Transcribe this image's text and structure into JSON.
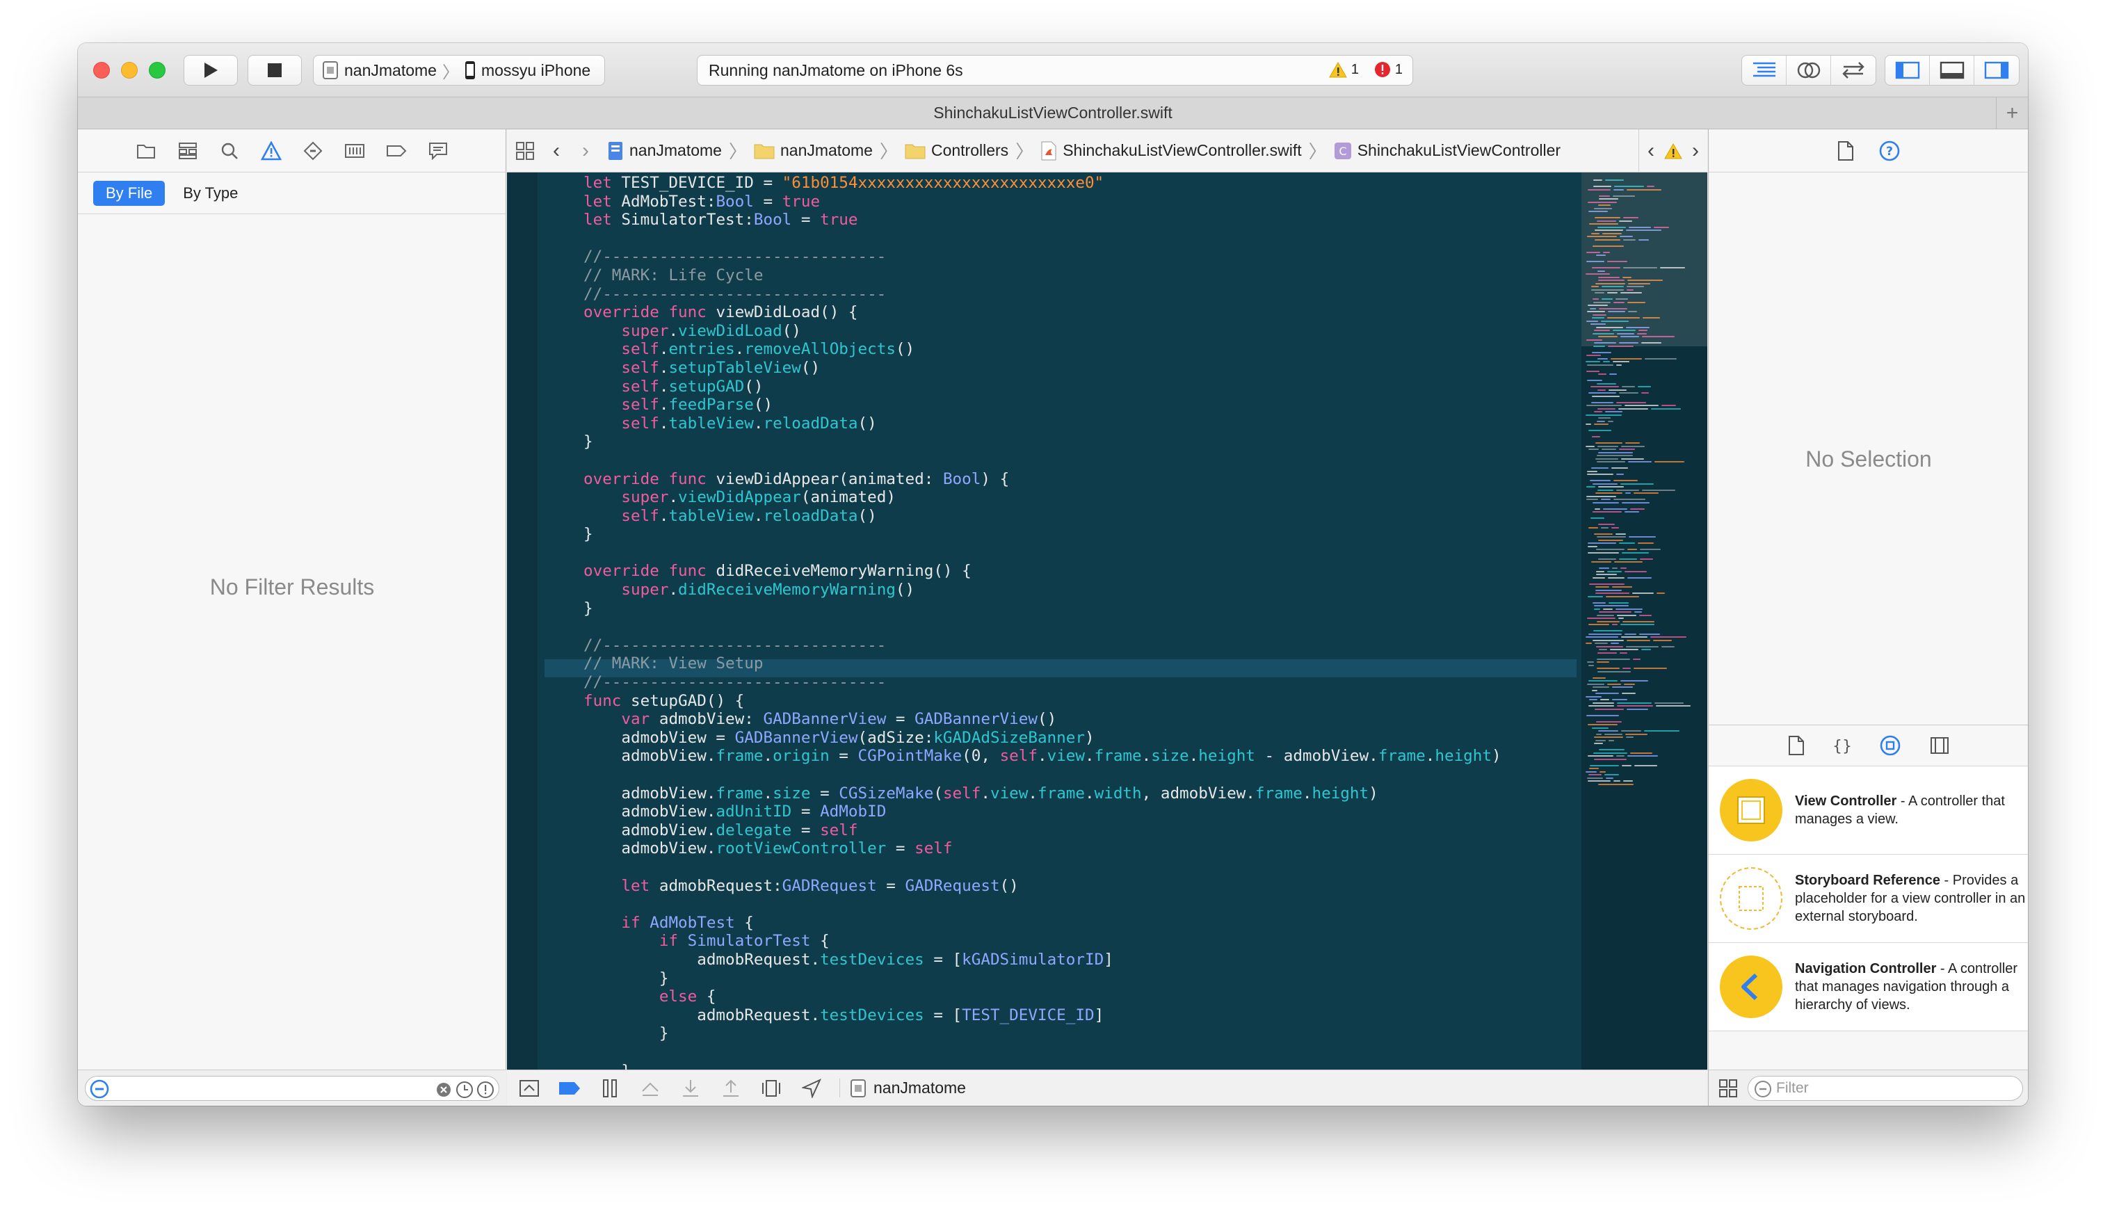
{
  "toolbar": {
    "scheme": "nanJmatome",
    "device": "mossyu  iPhone",
    "status": "Running nanJmatome on iPhone 6s",
    "warning_count": "1",
    "error_count": "1"
  },
  "tab": {
    "title": "ShinchakuListViewController.swift"
  },
  "navigator": {
    "scope_by_file": "By File",
    "scope_by_type": "By Type",
    "empty": "No Filter Results"
  },
  "jumpbar": {
    "project": "nanJmatome",
    "group": "nanJmatome",
    "folder": "Controllers",
    "file": "ShinchakuListViewController.swift",
    "symbol": "ShinchakuListViewController"
  },
  "debugbar": {
    "target": "nanJmatome"
  },
  "inspector": {
    "empty": "No Selection",
    "filter_placeholder": "Filter",
    "library": [
      {
        "title": "View Controller",
        "desc": " - A controller that manages a view."
      },
      {
        "title": "Storyboard Reference",
        "desc": " - Provides a placeholder for a view controller in an external storyboard."
      },
      {
        "title": "Navigation Controller",
        "desc": " - A controller that manages navigation through a hierarchy of views."
      }
    ]
  },
  "colors": {
    "editor_bg": "#0f3c4a",
    "keyword": "#f05c9f",
    "string": "#ff8e36",
    "comment": "#8c9ba3",
    "type": "#8fa8ff",
    "method": "#2ec6d0",
    "accent": "#2f7ff1",
    "library_icon": "#f7c51e"
  },
  "code": [
    [
      [
        "kw",
        "let"
      ],
      [
        "nm",
        " TEST_DEVICE_ID = "
      ],
      [
        "str",
        "\"61b0154xxxxxxxxxxxxxxxxxxxxxxxe0\""
      ]
    ],
    [
      [
        "kw",
        "let"
      ],
      [
        "nm",
        " AdMobTest:"
      ],
      [
        "ty",
        "Bool"
      ],
      [
        "nm",
        " = "
      ],
      [
        "kw",
        "true"
      ]
    ],
    [
      [
        "kw",
        "let"
      ],
      [
        "nm",
        " SimulatorTest:"
      ],
      [
        "ty",
        "Bool"
      ],
      [
        "nm",
        " = "
      ],
      [
        "kw",
        "true"
      ]
    ],
    [],
    [
      [
        "cm",
        "//------------------------------"
      ]
    ],
    [
      [
        "cm",
        "// MARK: Life Cycle"
      ]
    ],
    [
      [
        "cm",
        "//------------------------------"
      ]
    ],
    [
      [
        "kw",
        "override"
      ],
      [
        "nm",
        " "
      ],
      [
        "kw",
        "func"
      ],
      [
        "nm",
        " viewDidLoad() {"
      ]
    ],
    [
      [
        "nm",
        "    "
      ],
      [
        "kw",
        "super"
      ],
      [
        "nm",
        "."
      ],
      [
        "me",
        "viewDidLoad"
      ],
      [
        "nm",
        "()"
      ]
    ],
    [
      [
        "nm",
        "    "
      ],
      [
        "kw",
        "self"
      ],
      [
        "nm",
        "."
      ],
      [
        "me",
        "entries"
      ],
      [
        "nm",
        "."
      ],
      [
        "me",
        "removeAllObjects"
      ],
      [
        "nm",
        "()"
      ]
    ],
    [
      [
        "nm",
        "    "
      ],
      [
        "kw",
        "self"
      ],
      [
        "nm",
        "."
      ],
      [
        "me",
        "setupTableView"
      ],
      [
        "nm",
        "()"
      ]
    ],
    [
      [
        "nm",
        "    "
      ],
      [
        "kw",
        "self"
      ],
      [
        "nm",
        "."
      ],
      [
        "me",
        "setupGAD"
      ],
      [
        "nm",
        "()"
      ]
    ],
    [
      [
        "nm",
        "    "
      ],
      [
        "kw",
        "self"
      ],
      [
        "nm",
        "."
      ],
      [
        "me",
        "feedParse"
      ],
      [
        "nm",
        "()"
      ]
    ],
    [
      [
        "nm",
        "    "
      ],
      [
        "kw",
        "self"
      ],
      [
        "nm",
        "."
      ],
      [
        "me",
        "tableView"
      ],
      [
        "nm",
        "."
      ],
      [
        "me",
        "reloadData"
      ],
      [
        "nm",
        "()"
      ]
    ],
    [
      [
        "nm",
        "}"
      ]
    ],
    [],
    [
      [
        "kw",
        "override"
      ],
      [
        "nm",
        " "
      ],
      [
        "kw",
        "func"
      ],
      [
        "nm",
        " viewDidAppear(animated: "
      ],
      [
        "ty",
        "Bool"
      ],
      [
        "nm",
        ") {"
      ]
    ],
    [
      [
        "nm",
        "    "
      ],
      [
        "kw",
        "super"
      ],
      [
        "nm",
        "."
      ],
      [
        "me",
        "viewDidAppear"
      ],
      [
        "nm",
        "(animated)"
      ]
    ],
    [
      [
        "nm",
        "    "
      ],
      [
        "kw",
        "self"
      ],
      [
        "nm",
        "."
      ],
      [
        "me",
        "tableView"
      ],
      [
        "nm",
        "."
      ],
      [
        "me",
        "reloadData"
      ],
      [
        "nm",
        "()"
      ]
    ],
    [
      [
        "nm",
        "}"
      ]
    ],
    [],
    [
      [
        "kw",
        "override"
      ],
      [
        "nm",
        " "
      ],
      [
        "kw",
        "func"
      ],
      [
        "nm",
        " didReceiveMemoryWarning() {"
      ]
    ],
    [
      [
        "nm",
        "    "
      ],
      [
        "kw",
        "super"
      ],
      [
        "nm",
        "."
      ],
      [
        "me",
        "didReceiveMemoryWarning"
      ],
      [
        "nm",
        "()"
      ]
    ],
    [
      [
        "nm",
        "}"
      ]
    ],
    [],
    [
      [
        "cm",
        "//------------------------------"
      ]
    ],
    [
      [
        "cm",
        "// MARK: View Setup"
      ]
    ],
    [
      [
        "cm",
        "//------------------------------"
      ]
    ],
    [
      [
        "kw",
        "func"
      ],
      [
        "nm",
        " setupGAD() {"
      ]
    ],
    [
      [
        "nm",
        "    "
      ],
      [
        "kw",
        "var"
      ],
      [
        "nm",
        " admobView: "
      ],
      [
        "ty",
        "GADBannerView"
      ],
      [
        "nm",
        " = "
      ],
      [
        "ty",
        "GADBannerView"
      ],
      [
        "nm",
        "()"
      ]
    ],
    [
      [
        "nm",
        "    admobView = "
      ],
      [
        "ty",
        "GADBannerView"
      ],
      [
        "nm",
        "(adSize:"
      ],
      [
        "me",
        "kGADAdSizeBanner"
      ],
      [
        "nm",
        ")"
      ]
    ],
    [
      [
        "nm",
        "    admobView."
      ],
      [
        "me",
        "frame"
      ],
      [
        "nm",
        "."
      ],
      [
        "me",
        "origin"
      ],
      [
        "nm",
        " = "
      ],
      [
        "ty",
        "CGPointMake"
      ],
      [
        "nm",
        "(0, "
      ],
      [
        "kw",
        "self"
      ],
      [
        "nm",
        "."
      ],
      [
        "me",
        "view"
      ],
      [
        "nm",
        "."
      ],
      [
        "me",
        "frame"
      ],
      [
        "nm",
        "."
      ],
      [
        "me",
        "size"
      ],
      [
        "nm",
        "."
      ],
      [
        "me",
        "height"
      ],
      [
        "nm",
        " - admobView."
      ],
      [
        "me",
        "frame"
      ],
      [
        "nm",
        "."
      ],
      [
        "me",
        "height"
      ],
      [
        "nm",
        ")"
      ]
    ],
    [],
    [
      [
        "nm",
        "    admobView."
      ],
      [
        "me",
        "frame"
      ],
      [
        "nm",
        "."
      ],
      [
        "me",
        "size"
      ],
      [
        "nm",
        " = "
      ],
      [
        "ty",
        "CGSizeMake"
      ],
      [
        "nm",
        "("
      ],
      [
        "kw",
        "self"
      ],
      [
        "nm",
        "."
      ],
      [
        "me",
        "view"
      ],
      [
        "nm",
        "."
      ],
      [
        "me",
        "frame"
      ],
      [
        "nm",
        "."
      ],
      [
        "me",
        "width"
      ],
      [
        "nm",
        ", admobView."
      ],
      [
        "me",
        "frame"
      ],
      [
        "nm",
        "."
      ],
      [
        "me",
        "height"
      ],
      [
        "nm",
        ")"
      ]
    ],
    [
      [
        "nm",
        "    admobView."
      ],
      [
        "me",
        "adUnitID"
      ],
      [
        "nm",
        " = "
      ],
      [
        "ty",
        "AdMobID"
      ]
    ],
    [
      [
        "nm",
        "    admobView."
      ],
      [
        "me",
        "delegate"
      ],
      [
        "nm",
        " = "
      ],
      [
        "kw",
        "self"
      ]
    ],
    [
      [
        "nm",
        "    admobView."
      ],
      [
        "me",
        "rootViewController"
      ],
      [
        "nm",
        " = "
      ],
      [
        "kw",
        "self"
      ]
    ],
    [],
    [
      [
        "nm",
        "    "
      ],
      [
        "kw",
        "let"
      ],
      [
        "nm",
        " admobRequest:"
      ],
      [
        "ty",
        "GADRequest"
      ],
      [
        "nm",
        " = "
      ],
      [
        "ty",
        "GADRequest"
      ],
      [
        "nm",
        "()"
      ]
    ],
    [],
    [
      [
        "nm",
        "    "
      ],
      [
        "kw",
        "if"
      ],
      [
        "nm",
        " "
      ],
      [
        "ty",
        "AdMobTest"
      ],
      [
        "nm",
        " {"
      ]
    ],
    [
      [
        "nm",
        "        "
      ],
      [
        "kw",
        "if"
      ],
      [
        "nm",
        " "
      ],
      [
        "ty",
        "SimulatorTest"
      ],
      [
        "nm",
        " {"
      ]
    ],
    [
      [
        "nm",
        "            admobRequest."
      ],
      [
        "me",
        "testDevices"
      ],
      [
        "nm",
        " = ["
      ],
      [
        "ty",
        "kGADSimulatorID"
      ],
      [
        "nm",
        "]"
      ]
    ],
    [
      [
        "nm",
        "        }"
      ]
    ],
    [
      [
        "nm",
        "        "
      ],
      [
        "kw",
        "else"
      ],
      [
        "nm",
        " {"
      ]
    ],
    [
      [
        "nm",
        "            admobRequest."
      ],
      [
        "me",
        "testDevices"
      ],
      [
        "nm",
        " = ["
      ],
      [
        "ty",
        "TEST_DEVICE_ID"
      ],
      [
        "nm",
        "]"
      ]
    ],
    [
      [
        "nm",
        "        }"
      ]
    ],
    [],
    [
      [
        "nm",
        "    }"
      ]
    ]
  ]
}
